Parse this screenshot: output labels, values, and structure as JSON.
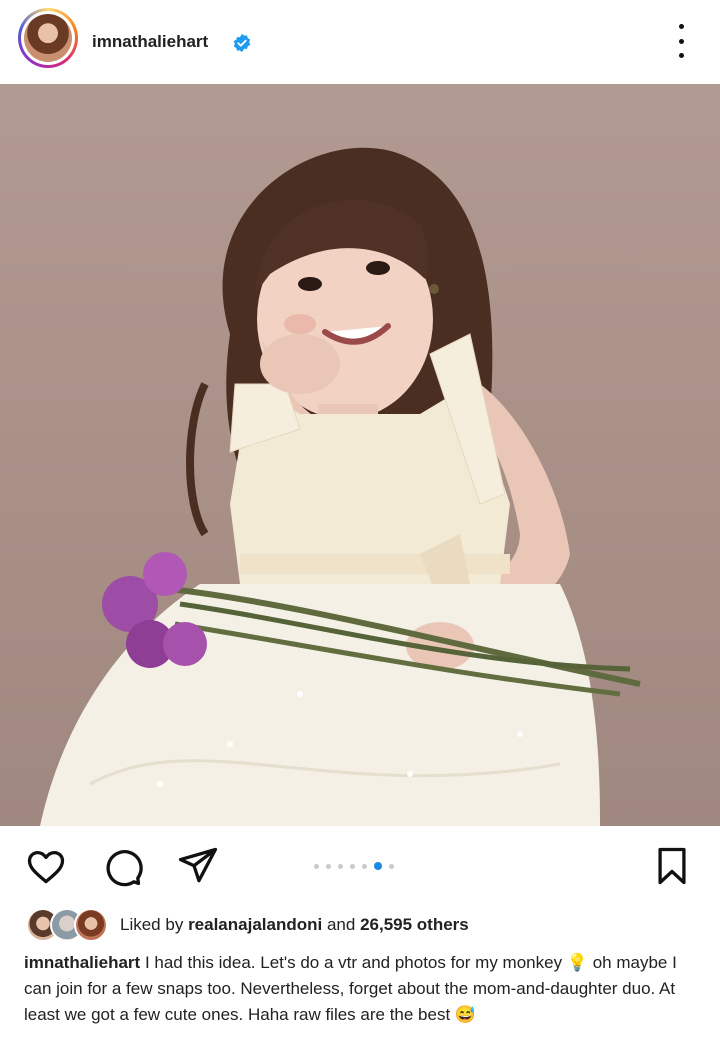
{
  "post": {
    "username": "imnathaliehart",
    "verified": true
  },
  "actions": {
    "like": "heart-icon",
    "comment": "comment-icon",
    "share": "share-icon",
    "save": "bookmark-icon",
    "carousel": {
      "count": 7,
      "active_index": 5,
      "accent": "#1e88e5"
    }
  },
  "likes": {
    "prefix": "Liked by",
    "user": "realanajalandoni",
    "middle": "and",
    "others": "26,595 others"
  },
  "caption": {
    "username": "imnathaliehart",
    "text": "I had this idea. Let's do a vtr and photos for my monkey 💡 oh maybe I can join for a few snaps too.  Nevertheless, forget about the mom-and-daughter duo. At least we got a few cute ones. Haha raw files are the best 😅"
  }
}
